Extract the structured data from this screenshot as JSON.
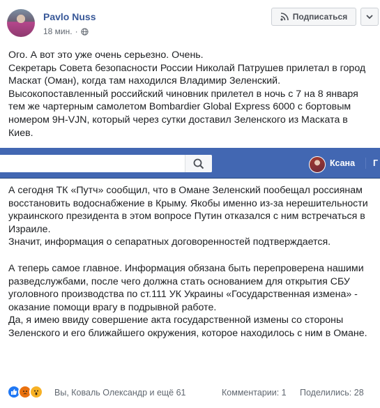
{
  "post": {
    "author": "Pavlo Nuss",
    "time": "18 мин.",
    "separator": "·",
    "subscribe_label": "Подписаться"
  },
  "paragraphs": {
    "top": "Ого. А вот это уже очень серьезно. Очень.\nСекретарь Совета безопасности России Николай Патрушев прилетал в город Маскат (Оман), когда там находился Владимир Зеленский.\nВысокопоставленный российский чиновник прилетел в ночь с 7 на 8 января тем же чартерным самолетом Bombardier Global Express 6000 с бортовым номером 9H-VJN, который через сутки доставил Зеленского из Маската в Киев.",
    "mid": "А сегодня ТК «Путч» сообщил, что в Омане Зеленский пообещал россиянам восстановить водоснабжение в Крыму. Якобы именно из-за нерешительности украинского президента в этом вопросе Путин отказался с ним встречаться в Израиле.\nЗначит, информация о сепаратных договоренностей подтверждается.",
    "low": "А теперь самое главное. Информация обязана быть перепроверена нашими разведслужбами, после чего должна стать основанием для открытия СБУ уголовного производства по ст.111 УК Украины «Государственная измена» - оказание помощи врагу в подрывной работе.\nДа, я имею ввиду совершение акта государственной измены со стороны Зеленского и его ближайшего окружения, которое находилось с ним в Омане."
  },
  "nav": {
    "user_name": "Ксана",
    "next_link": "Г"
  },
  "footer": {
    "reactors": "Вы, Коваль Олександр и ещё 61",
    "comments": "Комментарии: 1",
    "shares": "Поделились: 28"
  },
  "icons": [
    "globe-icon",
    "rss-icon",
    "chevron-down-icon",
    "search-icon",
    "like-icon",
    "angry-icon",
    "wow-icon"
  ],
  "colors": {
    "brand_blue": "#4267b2",
    "link_blue": "#385898",
    "text": "#1c1e21",
    "muted": "#606770"
  }
}
